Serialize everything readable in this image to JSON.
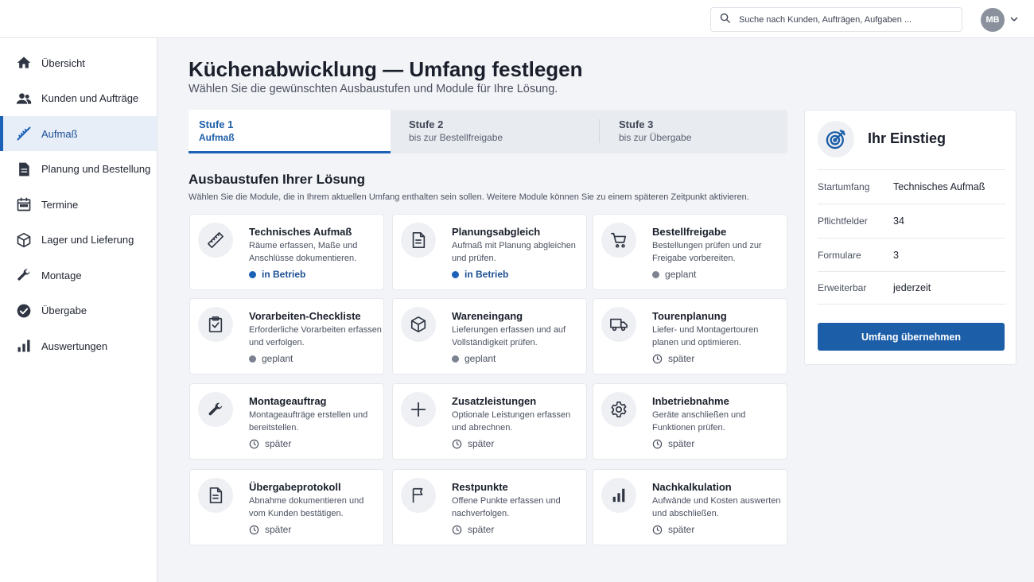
{
  "search": {
    "placeholder": "Suche nach Kunden, Aufträgen, Aufgaben ..."
  },
  "user": {
    "initials": "MB"
  },
  "sidebar": {
    "items": [
      {
        "label": "Übersicht",
        "icon": "home-icon"
      },
      {
        "label": "Kunden und Aufträge",
        "icon": "users-icon"
      },
      {
        "label": "Aufmaß",
        "icon": "ruler-pencil-icon",
        "active": true
      },
      {
        "label": "Planung und Bestellung",
        "icon": "document-icon"
      },
      {
        "label": "Termine",
        "icon": "calendar-icon"
      },
      {
        "label": "Lager und Lieferung",
        "icon": "box-icon"
      },
      {
        "label": "Montage",
        "icon": "wrench-icon"
      },
      {
        "label": "Übergabe",
        "icon": "check-circle-icon"
      },
      {
        "label": "Auswertungen",
        "icon": "bar-chart-icon"
      }
    ]
  },
  "page": {
    "title": "Küchenabwicklung — Umfang festlegen",
    "subtitle": "Wählen Sie die gewünschten Ausbaustufen und Module für Ihre Lösung."
  },
  "tabs": [
    {
      "title": "Stufe 1",
      "subtitle": "Aufmaß",
      "active": true
    },
    {
      "title": "Stufe 2",
      "subtitle": "bis zur Bestellfreigabe"
    },
    {
      "title": "Stufe 3",
      "subtitle": "bis zur Übergabe"
    }
  ],
  "section": {
    "title": "Ausbaustufen Ihrer Lösung",
    "subtitle": "Wählen Sie die Module, die in Ihrem aktuellen Umfang enthalten sein sollen. Weitere Module können Sie zu einem späteren Zeitpunkt aktivieren."
  },
  "modules": [
    {
      "title": "Technisches Aufmaß",
      "desc": "Räume erfassen, Maße und Anschlüsse dokumentieren.",
      "status": "in Betrieb",
      "state": "active",
      "icon": "ruler-icon"
    },
    {
      "title": "Planungsabgleich",
      "desc": "Aufmaß mit Planung abgleichen und prüfen.",
      "status": "in Betrieb",
      "state": "active",
      "icon": "document-icon"
    },
    {
      "title": "Bestellfreigabe",
      "desc": "Bestellungen prüfen und zur Freigabe vorbereiten.",
      "status": "geplant",
      "state": "planned",
      "icon": "cart-icon"
    },
    {
      "title": "Vorarbeiten-Checkliste",
      "desc": "Erforderliche Vorarbeiten erfassen und verfolgen.",
      "status": "geplant",
      "state": "planned",
      "icon": "checklist-icon"
    },
    {
      "title": "Wareneingang",
      "desc": "Lieferungen erfassen und auf Vollständigkeit prüfen.",
      "status": "geplant",
      "state": "planned",
      "icon": "box-icon"
    },
    {
      "title": "Tourenplanung",
      "desc": "Liefer- und Montagertouren planen und optimieren.",
      "status": "später",
      "state": "later",
      "icon": "truck-icon"
    },
    {
      "title": "Montageauftrag",
      "desc": "Montageaufträge erstellen und bereitstellen.",
      "status": "später",
      "state": "later",
      "icon": "wrench-icon"
    },
    {
      "title": "Zusatzleistungen",
      "desc": "Optionale Leistungen erfassen und abrechnen.",
      "status": "später",
      "state": "later",
      "icon": "plus-icon"
    },
    {
      "title": "Inbetriebnahme",
      "desc": "Geräte anschließen und Funktionen prüfen.",
      "status": "später",
      "state": "later",
      "icon": "gear-icon"
    },
    {
      "title": "Übergabeprotokoll",
      "desc": "Abnahme dokumentieren und vom Kunden bestätigen.",
      "status": "später",
      "state": "later",
      "icon": "document-icon"
    },
    {
      "title": "Restpunkte",
      "desc": "Offene Punkte erfassen und nachverfolgen.",
      "status": "später",
      "state": "later",
      "icon": "flag-icon"
    },
    {
      "title": "Nachkalkulation",
      "desc": "Aufwände und Kosten auswerten und abschließen.",
      "status": "später",
      "state": "later",
      "icon": "bar-chart-icon"
    }
  ],
  "panel": {
    "title": "Ihr Einstieg",
    "icon": "target-icon",
    "rows": [
      {
        "key": "Startumfang",
        "value": "Technisches Aufmaß"
      },
      {
        "key": "Pflichtfelder",
        "value": "34"
      },
      {
        "key": "Formulare",
        "value": "3"
      },
      {
        "key": "Erweiterbar",
        "value": "jederzeit"
      }
    ],
    "button": "Umfang übernehmen"
  },
  "colors": {
    "accent": "#1c63b7",
    "button": "#1c5ea8",
    "background": "#f3f4f7"
  }
}
